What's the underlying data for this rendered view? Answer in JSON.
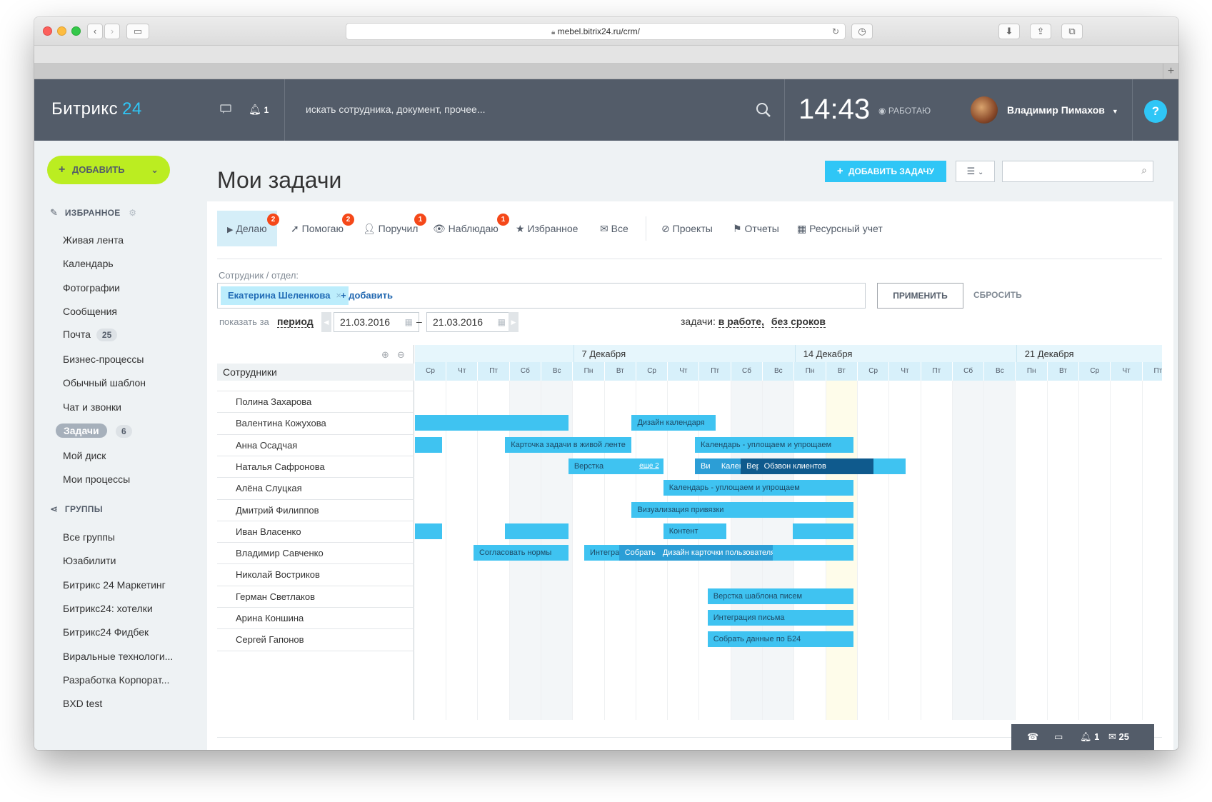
{
  "browser": {
    "url": "mebel.bitrix24.ru/crm/",
    "tab_plus": "+"
  },
  "header": {
    "logo_text": "Битрикс",
    "logo_num": "24",
    "notifications_count": "1",
    "search_placeholder": "искать сотрудника, документ, прочее...",
    "clock": "14:43",
    "work_status": "РАБОТАЮ",
    "user_name": "Владимир Пимахов",
    "help_label": "?"
  },
  "sidebar": {
    "add_button": "ДОБАВИТЬ",
    "favorites_title": "ИЗБРАННОЕ",
    "favorites": [
      {
        "label": "Живая лента"
      },
      {
        "label": "Календарь"
      },
      {
        "label": "Фотографии"
      },
      {
        "label": "Сообщения"
      },
      {
        "label": "Почта",
        "counter": "25"
      },
      {
        "label": "Бизнес-процессы"
      },
      {
        "label": "Обычный шаблон"
      },
      {
        "label": "Чат и звонки"
      },
      {
        "label": "Задачи",
        "counter": "6"
      },
      {
        "label": "Мой диск"
      },
      {
        "label": "Мои процессы"
      }
    ],
    "groups_title": "ГРУППЫ",
    "groups": [
      {
        "label": "Все группы"
      },
      {
        "label": "Юзабилити"
      },
      {
        "label": "Битрикс 24 Маркетинг"
      },
      {
        "label": "Битрикс24: хотелки"
      },
      {
        "label": "Битрикс24 Фидбек"
      },
      {
        "label": "Виральные технологи..."
      },
      {
        "label": "Разработка Корпорат..."
      },
      {
        "label": "BXD test"
      }
    ]
  },
  "main": {
    "title": "Мои задачи",
    "add_task": "ДОБАВИТЬ ЗАДАЧУ",
    "tabs": [
      {
        "label": "Делаю",
        "badge": "2"
      },
      {
        "label": "Помогаю",
        "badge": "2"
      },
      {
        "label": "Поручил",
        "badge": "1"
      },
      {
        "label": "Наблюдаю",
        "badge": "1"
      },
      {
        "label": "Избранное"
      },
      {
        "label": "Все"
      },
      {
        "label": "Проекты"
      },
      {
        "label": "Отчеты"
      },
      {
        "label": "Ресурсный учет"
      }
    ],
    "filter": {
      "employee_label": "Сотрудник / отдел:",
      "selected_employee": "Екатерина Шеленкова",
      "add_link": "+ добавить",
      "apply": "ПРИМЕНИТЬ",
      "reset": "СБРОСИТЬ",
      "show_for": "показать за",
      "period": "период",
      "date_from": "21.03.2016",
      "date_to": "21.03.2016",
      "dash": "–",
      "tasks_label": "задачи:",
      "in_work": "в работе,",
      "no_deadline": "без сроков"
    }
  },
  "gantt": {
    "employees_header": "Сотрудники",
    "weeks": [
      "7 Декабря",
      "14 Декабря",
      "21 Декабря"
    ],
    "days": [
      "Ср",
      "Чт",
      "Пт",
      "Сб",
      "Вс",
      "Пн",
      "Вт",
      "Ср",
      "Чт",
      "Пт",
      "Сб",
      "Вс",
      "Пн",
      "Вт",
      "Ср",
      "Чт",
      "Пт",
      "Сб",
      "Вс",
      "Пн",
      "Вт",
      "Ср",
      "Чт",
      "Пт",
      "Сб",
      "Вс",
      "Пн",
      "Вт",
      "Ср",
      "Чт",
      "Пт",
      "Сб",
      "Вс",
      "Пн",
      "Вт"
    ],
    "weekend_indexes": [
      3,
      4,
      10,
      11,
      17,
      18,
      24,
      25
    ],
    "today_index": 13,
    "employees": [
      "Полина Захарова",
      "Валентина Кожухова",
      "Анна Осадчая",
      "Наталья Сафронова",
      "Алёна Слуцкая",
      "Дмитрий Филиппов",
      "Иван Власенко",
      "Владимир Савченко",
      "Николай Востриков",
      "Герман Светлаков",
      "Арина Коншина",
      "Сергей Гапонов"
    ],
    "bars": [
      {
        "row": 1,
        "start": 0,
        "end": 4.85,
        "label": "",
        "style": "light"
      },
      {
        "row": 1,
        "start": 6.85,
        "end": 9.5,
        "label": "Дизайн календаря",
        "style": "light"
      },
      {
        "row": 2,
        "start": 0,
        "end": 0.85,
        "label": "",
        "style": "light"
      },
      {
        "row": 2,
        "start": 2.85,
        "end": 6.85,
        "label": "Карточка задачи в живой ленте",
        "style": "light"
      },
      {
        "row": 2,
        "start": 8.85,
        "end": 13.85,
        "label": "Календарь - уплощаем и упрощаем",
        "style": "light"
      },
      {
        "row": 3,
        "start": 4.85,
        "end": 7.85,
        "label": "Верстка",
        "style": "light",
        "more": "еще 2"
      },
      {
        "row": 3,
        "start": 8.85,
        "end": 15.5,
        "label": "",
        "style": "light"
      },
      {
        "row": 3,
        "start": 8.85,
        "end": 9.5,
        "label": "Ви",
        "style": "mid"
      },
      {
        "row": 3,
        "start": 9.5,
        "end": 10.3,
        "label": "Кален",
        "style": "mid"
      },
      {
        "row": 3,
        "start": 10.3,
        "end": 10.85,
        "label": "Вер",
        "style": "dark"
      },
      {
        "row": 3,
        "start": 10.85,
        "end": 14.5,
        "label": "Обзвон клиентов",
        "style": "dark"
      },
      {
        "row": 4,
        "start": 7.85,
        "end": 13.85,
        "label": "Календарь - уплощаем и упрощаем",
        "style": "light"
      },
      {
        "row": 5,
        "start": 6.85,
        "end": 13.85,
        "label": "Визуализация привязки",
        "style": "light"
      },
      {
        "row": 6,
        "start": 0,
        "end": 0.85,
        "label": "",
        "style": "light"
      },
      {
        "row": 6,
        "start": 2.85,
        "end": 4.85,
        "label": "",
        "style": "light"
      },
      {
        "row": 6,
        "start": 7.85,
        "end": 9.85,
        "label": "Контент",
        "style": "light"
      },
      {
        "row": 6,
        "start": 11.95,
        "end": 13.85,
        "label": "",
        "style": "light"
      },
      {
        "row": 7,
        "start": 1.85,
        "end": 4.85,
        "label": "Согласовать нормы",
        "style": "light"
      },
      {
        "row": 7,
        "start": 5.35,
        "end": 13.85,
        "label": "",
        "style": "light"
      },
      {
        "row": 7,
        "start": 5.35,
        "end": 6.45,
        "label": "Интеграц",
        "style": "light"
      },
      {
        "row": 7,
        "start": 6.45,
        "end": 7.65,
        "label": "Собрать да",
        "style": "mid"
      },
      {
        "row": 7,
        "start": 7.65,
        "end": 11.3,
        "label": "Дизайн карточки пользователя",
        "style": "mid"
      },
      {
        "row": 9,
        "start": 9.25,
        "end": 13.85,
        "label": "Верстка шаблона писем",
        "style": "light"
      },
      {
        "row": 10,
        "start": 9.25,
        "end": 13.85,
        "label": "Интеграция письма",
        "style": "light"
      },
      {
        "row": 11,
        "start": 9.25,
        "end": 13.85,
        "label": "Собрать данные по Б24",
        "style": "light"
      }
    ]
  },
  "footer": {
    "notifications": "1",
    "mail": "25"
  },
  "colors": {
    "header_bg": "#535c69",
    "accent_blue": "#2fc6f6",
    "add_green": "#bbed21",
    "badge_red": "#f54819",
    "bar_light": "#3fc3f1",
    "bar_dark": "#0f5a8d"
  },
  "icons": [
    "chat-icon",
    "bell-icon",
    "search-icon",
    "help-icon",
    "pin-icon",
    "gear-icon",
    "share-icon",
    "calendar-icon",
    "zoom-in-icon",
    "zoom-out-icon",
    "phone-icon",
    "mail-icon"
  ]
}
